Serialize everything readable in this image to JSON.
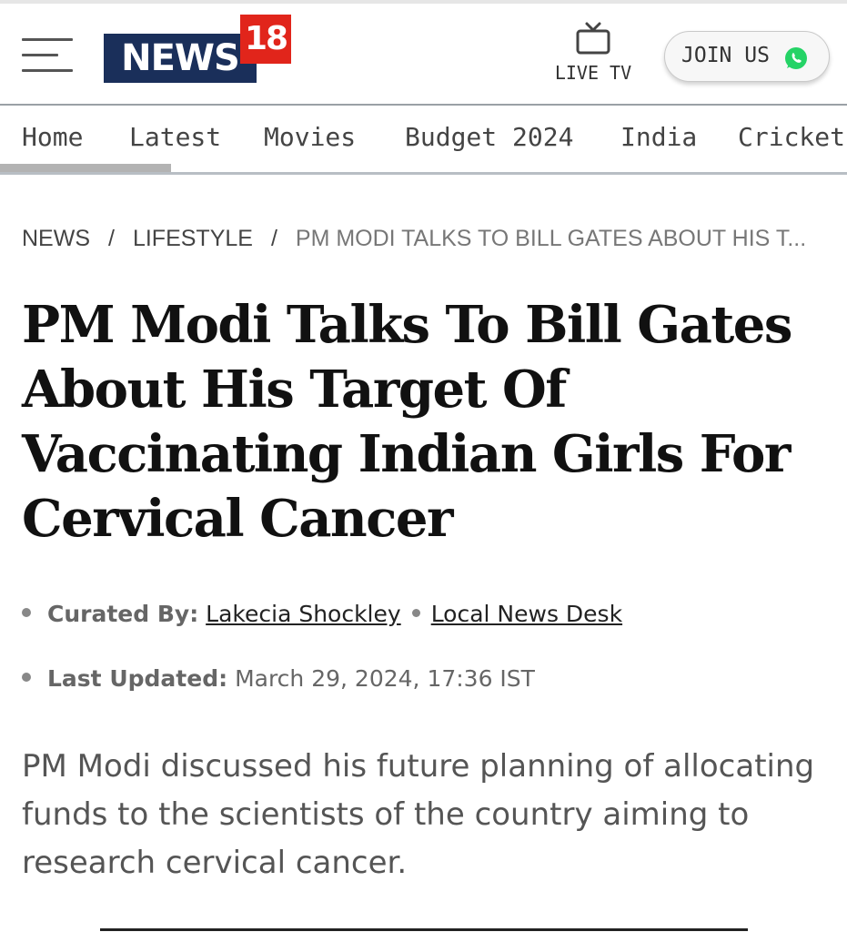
{
  "header": {
    "logo_text": "NEWS",
    "logo_number": "18",
    "live_tv_label": "LIVE TV",
    "join_label": "JOIN US"
  },
  "nav": {
    "items": [
      {
        "label": "Home"
      },
      {
        "label": "Latest"
      },
      {
        "label": "Movies"
      },
      {
        "label": "Budget 2024"
      },
      {
        "label": "India"
      },
      {
        "label": "Cricket"
      }
    ],
    "active_index": 0
  },
  "breadcrumb": {
    "items": [
      "NEWS",
      "LIFESTYLE"
    ],
    "separator": "/",
    "current": "PM MODI TALKS TO BILL GATES ABOUT HIS T..."
  },
  "article": {
    "headline": "PM Modi Talks To Bill Gates About His Target Of Vaccinating Indian Girls For Cervical Cancer",
    "curated_label": "Curated By:",
    "author": "Lakecia Shockley",
    "desk": "Local News Desk",
    "updated_label": "Last Updated:",
    "updated_value": "March 29, 2024, 17:36 IST",
    "summary": "PM Modi discussed his future planning of allocating funds to the scientists of the country aiming to research cervical cancer."
  },
  "colors": {
    "logo_navy": "#1a2f5a",
    "logo_red": "#e1251b",
    "whatsapp_green": "#25d366"
  },
  "icons": {
    "menu": "hamburger-icon",
    "tv": "tv-icon",
    "whatsapp": "whatsapp-icon"
  }
}
